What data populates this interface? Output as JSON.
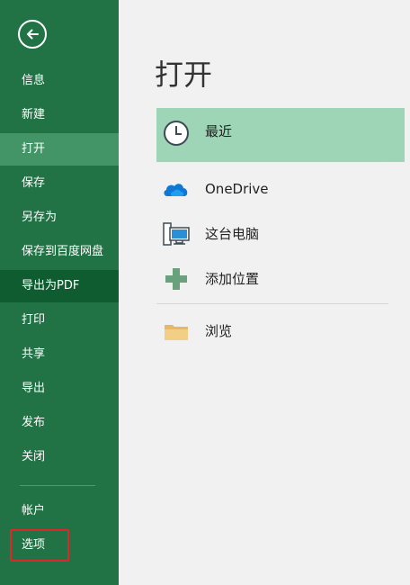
{
  "sidebar": {
    "items": [
      {
        "label": "信息"
      },
      {
        "label": "新建"
      },
      {
        "label": "打开"
      },
      {
        "label": "保存"
      },
      {
        "label": "另存为"
      },
      {
        "label": "保存到百度网盘"
      },
      {
        "label": "导出为PDF"
      },
      {
        "label": "打印"
      },
      {
        "label": "共享"
      },
      {
        "label": "导出"
      },
      {
        "label": "发布"
      },
      {
        "label": "关闭"
      },
      {
        "label": "帐户"
      },
      {
        "label": "选项"
      }
    ]
  },
  "main": {
    "title": "打开",
    "locations": [
      {
        "label": "最近",
        "icon": "clock-icon"
      },
      {
        "label": "OneDrive",
        "icon": "onedrive-cloud-icon"
      },
      {
        "label": "这台电脑",
        "icon": "computer-icon"
      },
      {
        "label": "添加位置",
        "icon": "plus-icon"
      },
      {
        "label": "浏览",
        "icon": "folder-icon"
      }
    ]
  },
  "colors": {
    "sidebar_bg": "#217346",
    "sidebar_active": "#439467",
    "sidebar_dark": "#0e5c2f",
    "selected_location": "#9fd5b7",
    "highlight_border": "#e0262a"
  }
}
